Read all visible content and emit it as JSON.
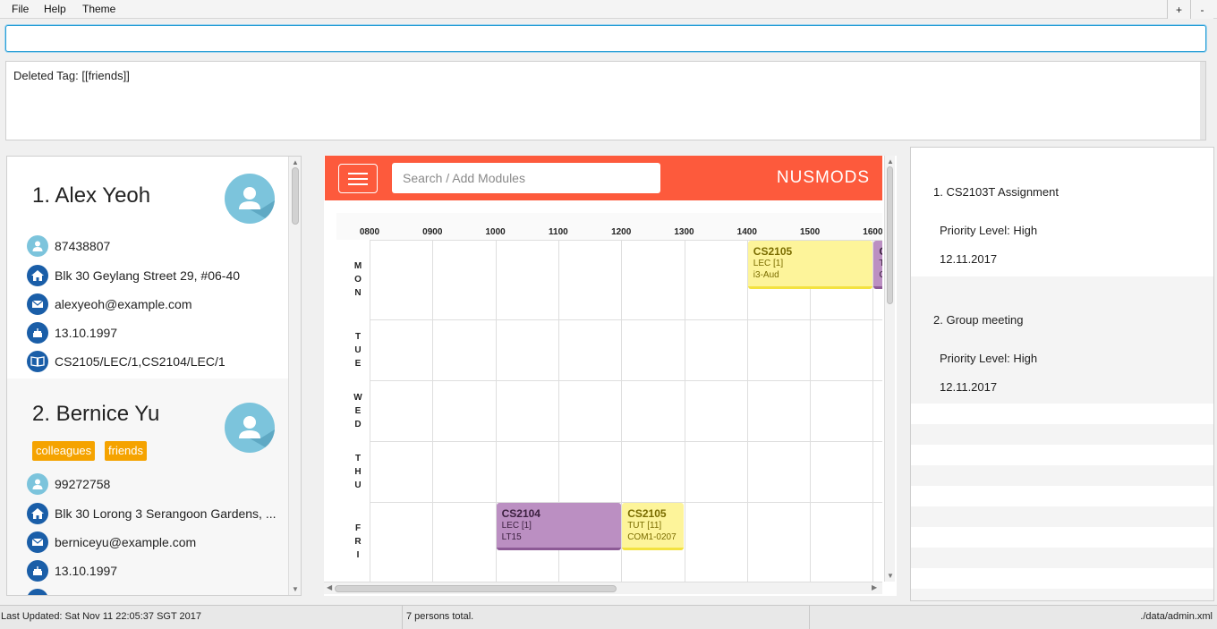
{
  "menu": {
    "file": "File",
    "help": "Help",
    "theme": "Theme",
    "zoom_in": "+",
    "zoom_out": "-"
  },
  "command": {
    "value": "",
    "placeholder": ""
  },
  "result": {
    "text": "Deleted Tag: [[friends]]"
  },
  "persons": [
    {
      "name": "1. Alex Yeoh",
      "tags": [],
      "phone": "87438807",
      "address": "Blk 30 Geylang Street 29, #06-40",
      "email": "alexyeoh@example.com",
      "birthday": "13.10.1997",
      "modules": "CS2105/LEC/1,CS2104/LEC/1"
    },
    {
      "name": "2. Bernice Yu",
      "tags": [
        "colleagues",
        "friends"
      ],
      "phone": "99272758",
      "address": "Blk 30 Lorong 3 Serangoon Gardens, ...",
      "email": "berniceyu@example.com",
      "birthday": "13.10.1997"
    }
  ],
  "nusmods": {
    "search_placeholder": "Search / Add Modules",
    "logo": "NUSMODS",
    "times": [
      "0800",
      "0900",
      "1000",
      "1100",
      "1200",
      "1300",
      "1400",
      "1500",
      "1600"
    ],
    "days": [
      "MON",
      "TUE",
      "WED",
      "THU",
      "FRI"
    ],
    "lessons": [
      {
        "code": "CS2105",
        "type": "LEC [1]",
        "venue": "i3-Aud",
        "day": "MON",
        "start": "1400",
        "end": "1600",
        "color": "yellow"
      },
      {
        "code": "C",
        "type": "T",
        "venue": "C",
        "day": "MON",
        "start": "1600",
        "end": "1800",
        "color": "purple"
      },
      {
        "code": "CS2104",
        "type": "LEC [1]",
        "venue": "LT15",
        "day": "FRI",
        "start": "1000",
        "end": "1200",
        "color": "purple"
      },
      {
        "code": "CS2105",
        "type": "TUT [11]",
        "venue": "COM1-0207",
        "day": "FRI",
        "start": "1200",
        "end": "1300",
        "color": "yellow"
      }
    ]
  },
  "tasks": [
    {
      "title": "1. CS2103T Assignment",
      "priority": "Priority Level: High",
      "date": "12.11.2017"
    },
    {
      "title": "2. Group meeting",
      "priority": "Priority Level: High",
      "date": "12.11.2017"
    }
  ],
  "status": {
    "last_updated": "Last Updated: Sat Nov 11 22:05:37 SGT 2017",
    "total": "7 persons total.",
    "path": "./data/admin.xml"
  },
  "colors": {
    "accent": "#2a9fd6",
    "nusmods": "#fd5a3c",
    "tag": "#f5a300",
    "icon": "#1a5ea8",
    "avatar": "#7cc4dc",
    "yellow_module": "#fdf49a",
    "purple_module": "#bb8fc2"
  }
}
